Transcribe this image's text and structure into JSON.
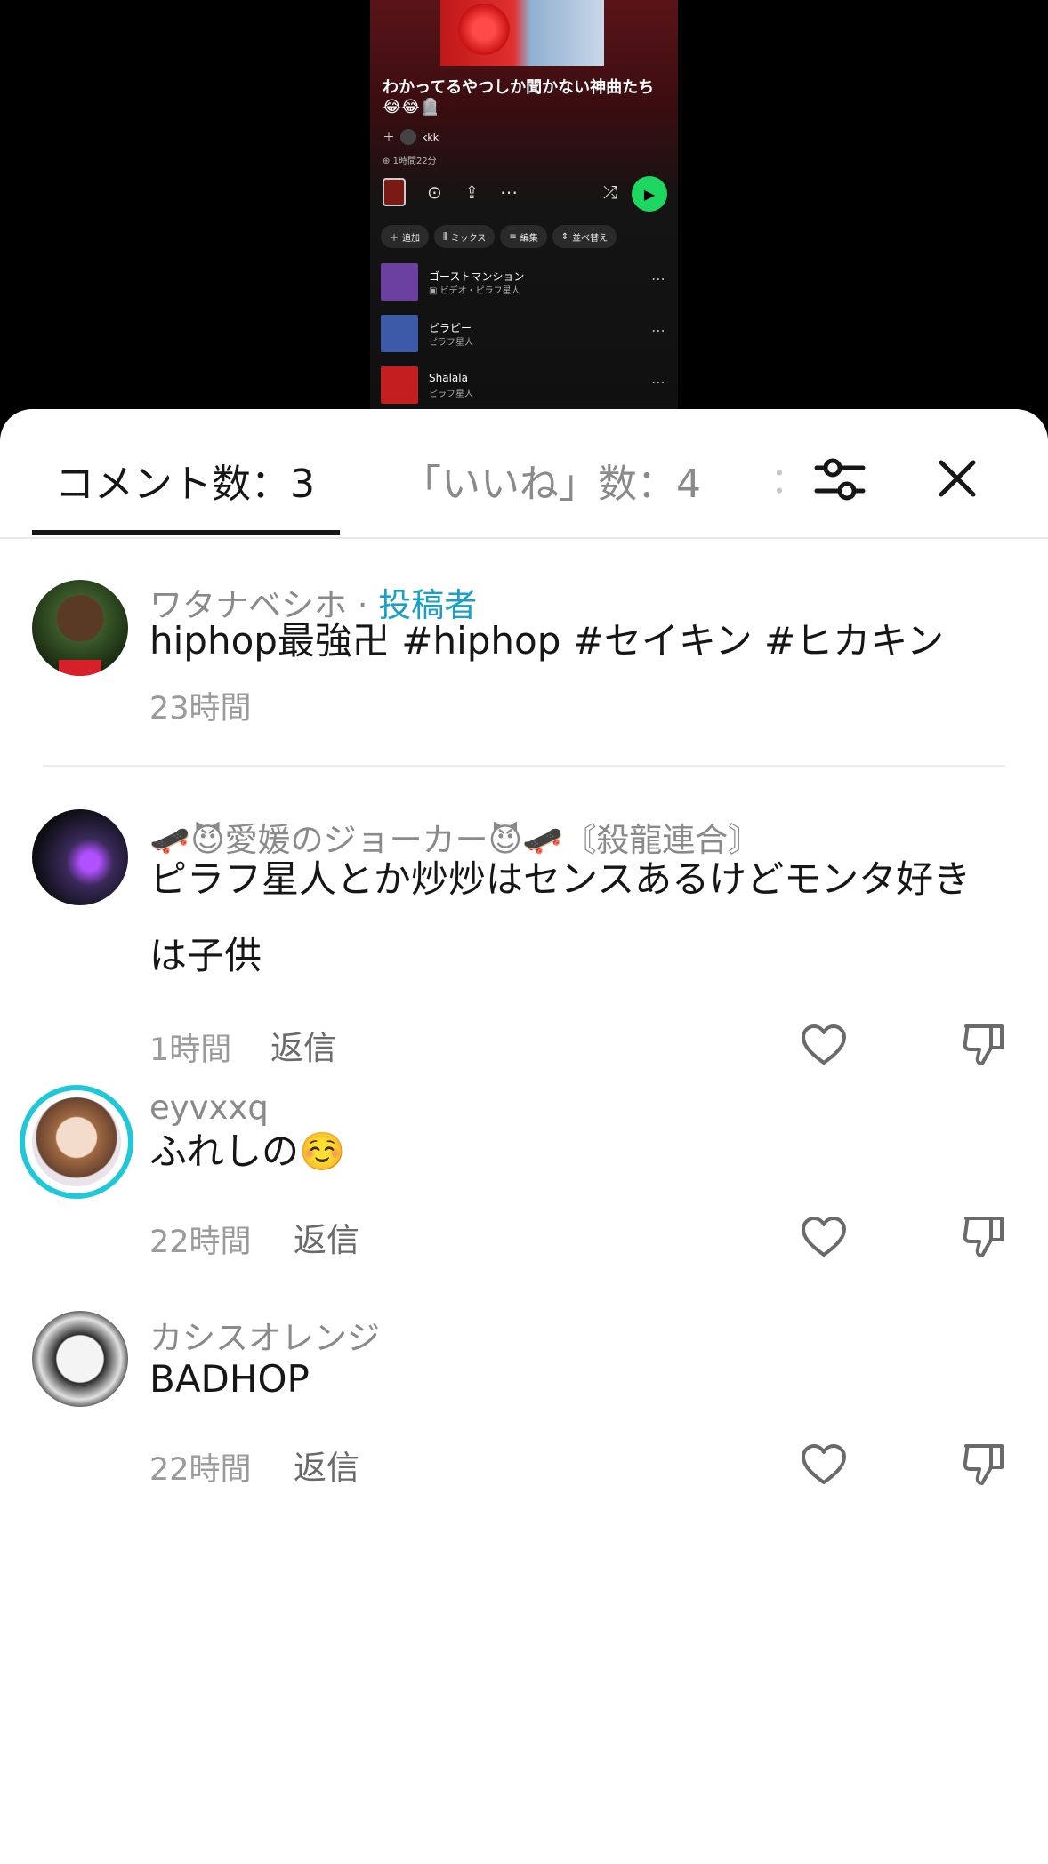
{
  "video_preview": {
    "playlist_title": "わかってるやつしか聞かない神曲たち😂😂🪦",
    "owner": "kkk",
    "duration": "1時間22分",
    "actions": [
      {
        "icon": "plus-icon",
        "label": "追加"
      },
      {
        "icon": "mix-icon",
        "label": "ミックス"
      },
      {
        "icon": "list-icon",
        "label": "編集"
      },
      {
        "icon": "sort-icon",
        "label": "並べ替え"
      }
    ],
    "tracks": [
      {
        "title": "ゴーストマンション",
        "subtitle": "ビデオ・ピラフ星人",
        "art_color": "#6b3fa0"
      },
      {
        "title": "ピラピー",
        "subtitle": "ピラフ星人",
        "art_color": "#3d5aa8"
      },
      {
        "title": "Shalala",
        "subtitle": "ピラフ星人",
        "art_color": "#c41e1e"
      }
    ],
    "play_color": "#1ed760"
  },
  "tabs": {
    "comments": "コメント数：3",
    "likes": "「いいね」数：4",
    "more": "："
  },
  "comments": [
    {
      "username": "ワタナベシホ",
      "separator": " · ",
      "author_tag": "投稿者",
      "text": "hiphop最強卍 #hiphop #セイキン #ヒカキン",
      "time": "23時間"
    },
    {
      "username": "🛹😈愛媛のジョーカー😈🛹〘殺龍連合〙",
      "text": "ピラフ星人とか炒炒はセンスあるけどモンタ好きは子供",
      "time": "1時間",
      "reply": "返信"
    },
    {
      "username": "eyvxxq",
      "text": "ふれしの☺️",
      "time": "22時間",
      "reply": "返信"
    },
    {
      "username": "カシスオレンジ",
      "text": "BADHOP",
      "time": "22時間",
      "reply": "返信"
    }
  ],
  "colors": {
    "author_tag": "#1a9fc6",
    "story_ring": "#1ec8d8"
  }
}
